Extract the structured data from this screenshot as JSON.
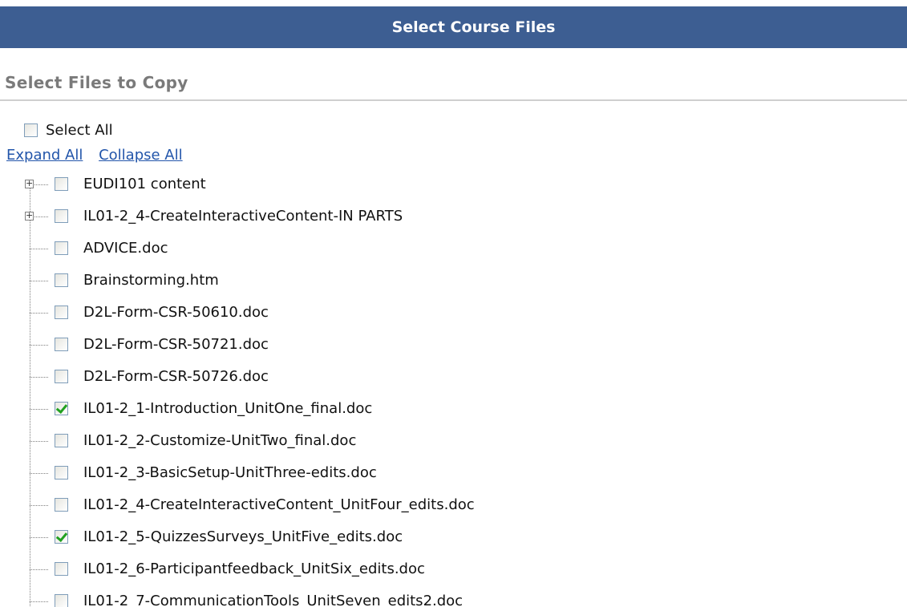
{
  "title": "Select Course Files",
  "section_header": "Select Files to Copy",
  "select_all": {
    "label": "Select All",
    "checked": false
  },
  "links": {
    "expand_all": "Expand All",
    "collapse_all": "Collapse All"
  },
  "tree_items": [
    {
      "label": "EUDI101 content",
      "checked": false,
      "folder": true
    },
    {
      "label": "IL01-2_4-CreateInteractiveContent-IN PARTS",
      "checked": false,
      "folder": true
    },
    {
      "label": "ADVICE.doc",
      "checked": false,
      "folder": false
    },
    {
      "label": "Brainstorming.htm",
      "checked": false,
      "folder": false
    },
    {
      "label": "D2L-Form-CSR-50610.doc",
      "checked": false,
      "folder": false
    },
    {
      "label": "D2L-Form-CSR-50721.doc",
      "checked": false,
      "folder": false
    },
    {
      "label": "D2L-Form-CSR-50726.doc",
      "checked": false,
      "folder": false
    },
    {
      "label": "IL01-2_1-Introduction_UnitOne_final.doc",
      "checked": true,
      "folder": false
    },
    {
      "label": "IL01-2_2-Customize-UnitTwo_final.doc",
      "checked": false,
      "folder": false
    },
    {
      "label": "IL01-2_3-BasicSetup-UnitThree-edits.doc",
      "checked": false,
      "folder": false
    },
    {
      "label": "IL01-2_4-CreateInteractiveContent_UnitFour_edits.doc",
      "checked": false,
      "folder": false
    },
    {
      "label": "IL01-2_5-QuizzesSurveys_UnitFive_edits.doc",
      "checked": true,
      "folder": false
    },
    {
      "label": "IL01-2_6-Participantfeedback_UnitSix_edits.doc",
      "checked": false,
      "folder": false
    },
    {
      "label": "IL01-2_7-CommunicationTools_UnitSeven_edits2.doc",
      "checked": false,
      "folder": false
    }
  ],
  "colors": {
    "title_bar": "#3d5e92",
    "link": "#2255aa",
    "check": "#21a121"
  }
}
